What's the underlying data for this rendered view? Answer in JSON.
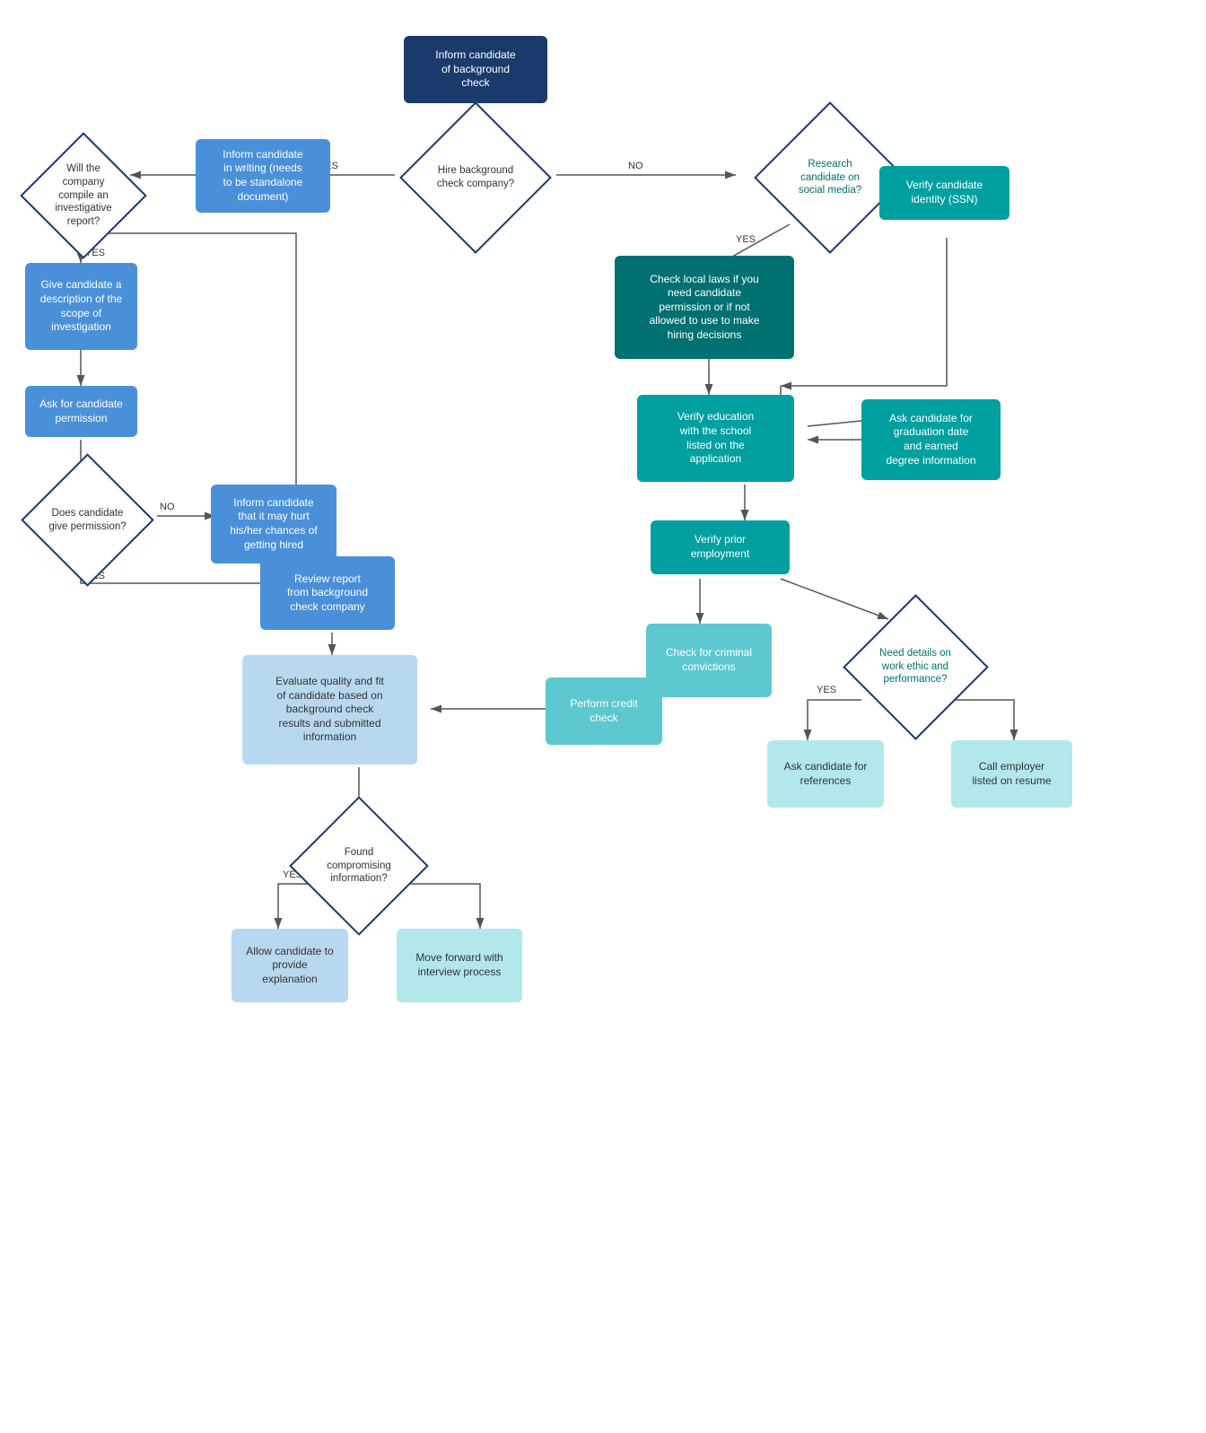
{
  "nodes": {
    "inform_candidate": {
      "label": "Inform candidate\nof background\ncheck"
    },
    "hire_bg_company": {
      "label": "Hire background\ncheck company?"
    },
    "research_social": {
      "label": "Research\ncandidate on\nsocial media?"
    },
    "inform_writing": {
      "label": "Inform candidate\nin writing (needs\nto be standalone\ndocument)"
    },
    "will_compile": {
      "label": "Will the\ncompany\ncompile an\ninvestigative\nreport?"
    },
    "check_local_laws": {
      "label": "Check local laws if you\nneed candidate\npermission or if not\nallowed to use to make\nhiring decisions"
    },
    "verify_identity": {
      "label": "Verify candidate\nidentity (SSN)"
    },
    "give_description": {
      "label": "Give candidate a\ndescription of the\nscope of\ninvestigation"
    },
    "ask_permission": {
      "label": "Ask for candidate\npermission"
    },
    "verify_education": {
      "label": "Verify education\nwith the school\nlisted on the\napplication"
    },
    "ask_graduation": {
      "label": "Ask candidate for\ngraduation date\nand earned\ndegree information"
    },
    "does_candidate_give": {
      "label": "Does candidate\ngive permission?"
    },
    "inform_hurt": {
      "label": "Inform candidate\nthat it may hurt\nhis/her chances of\ngetting hired"
    },
    "verify_employment": {
      "label": "Verify prior\nemployment"
    },
    "review_report": {
      "label": "Review report\nfrom background\ncheck company"
    },
    "check_criminal": {
      "label": "Check for criminal\nconvictions"
    },
    "need_details": {
      "label": "Need details on\nwork ethic and\nperformance?"
    },
    "evaluate_quality": {
      "label": "Evaluate quality and fit\nof candidate based on\nbackground check\nresults and submitted\ninformation"
    },
    "perform_credit": {
      "label": "Perform credit\ncheck"
    },
    "ask_references": {
      "label": "Ask candidate for\nreferences"
    },
    "call_employer": {
      "label": "Call employer\nlisted on resume"
    },
    "found_compromising": {
      "label": "Found\ncompromising\ninformation?"
    },
    "allow_candidate": {
      "label": "Allow candidate to\nprovide\nexplanation"
    },
    "move_forward": {
      "label": "Move forward with\ninterview process"
    }
  },
  "labels": {
    "yes": "YES",
    "no": "NO"
  }
}
